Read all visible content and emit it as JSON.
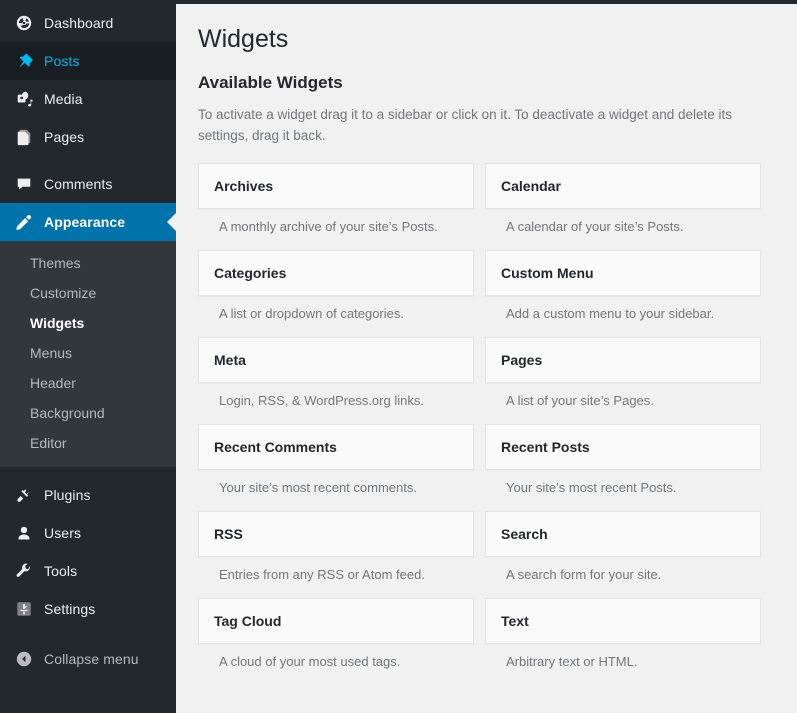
{
  "sidebar": {
    "items": [
      {
        "label": "Dashboard",
        "icon": "dashboard-icon",
        "state": "normal"
      },
      {
        "label": "Posts",
        "icon": "pin-icon",
        "state": "hovered"
      },
      {
        "label": "Media",
        "icon": "media-icon",
        "state": "normal"
      },
      {
        "label": "Pages",
        "icon": "pages-icon",
        "state": "normal"
      },
      {
        "label": "Comments",
        "icon": "comment-icon",
        "state": "normal"
      },
      {
        "label": "Appearance",
        "icon": "appearance-brush-icon",
        "state": "current"
      },
      {
        "label": "Plugins",
        "icon": "plugins-icon",
        "state": "normal"
      },
      {
        "label": "Users",
        "icon": "users-icon",
        "state": "normal"
      },
      {
        "label": "Tools",
        "icon": "tools-wrench-icon",
        "state": "normal"
      },
      {
        "label": "Settings",
        "icon": "settings-gear-icon",
        "state": "normal"
      }
    ],
    "submenu": [
      {
        "label": "Themes",
        "current": false
      },
      {
        "label": "Customize",
        "current": false
      },
      {
        "label": "Widgets",
        "current": true
      },
      {
        "label": "Menus",
        "current": false
      },
      {
        "label": "Header",
        "current": false
      },
      {
        "label": "Background",
        "current": false
      },
      {
        "label": "Editor",
        "current": false
      }
    ],
    "collapse": {
      "label": "Collapse menu",
      "icon": "collapse-arrow-icon"
    },
    "colors": {
      "background": "#23282d",
      "submenu_background": "#32373c",
      "current_background": "#0073aa",
      "hover_text": "#00b9eb"
    }
  },
  "main": {
    "page_title": "Widgets",
    "section_title": "Available Widgets",
    "section_description": "To activate a widget drag it to a sidebar or click on it. To deactivate a widget and delete its settings, drag it back.",
    "widgets_left": [
      {
        "title": "Archives",
        "description": "A monthly archive of your site’s Posts."
      },
      {
        "title": "Categories",
        "description": "A list or dropdown of categories."
      },
      {
        "title": "Meta",
        "description": "Login, RSS, & WordPress.org links."
      },
      {
        "title": "Recent Comments",
        "description": "Your site’s most recent comments."
      },
      {
        "title": "RSS",
        "description": "Entries from any RSS or Atom feed."
      },
      {
        "title": "Tag Cloud",
        "description": "A cloud of your most used tags."
      }
    ],
    "widgets_right": [
      {
        "title": "Calendar",
        "description": "A calendar of your site’s Posts."
      },
      {
        "title": "Custom Menu",
        "description": "Add a custom menu to your sidebar."
      },
      {
        "title": "Pages",
        "description": "A list of your site’s Pages."
      },
      {
        "title": "Recent Posts",
        "description": "Your site’s most recent Posts."
      },
      {
        "title": "Search",
        "description": "A search form for your site."
      },
      {
        "title": "Text",
        "description": "Arbitrary text or HTML."
      }
    ]
  }
}
